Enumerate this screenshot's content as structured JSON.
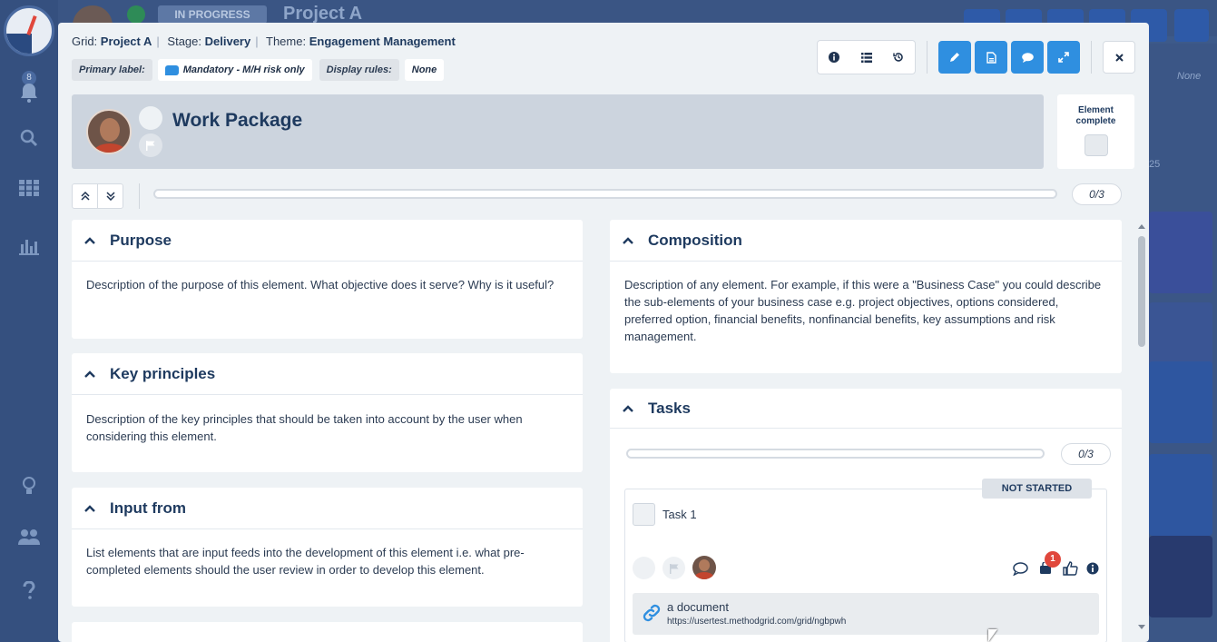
{
  "background": {
    "status_badge": "IN PROGRESS",
    "project_title": "Project A",
    "notification_count": "8",
    "right_col_label": "None",
    "right_col_number": "25"
  },
  "meta": {
    "grid_label": "Grid:",
    "grid_value": "Project A",
    "stage_label": "Stage:",
    "stage_value": "Delivery",
    "theme_label": "Theme:",
    "theme_value": "Engagement Management"
  },
  "labels": {
    "primary_label_title": "Primary label:",
    "primary_label_value": "Mandatory - M/H risk only",
    "display_rules_title": "Display rules:",
    "display_rules_value": "None"
  },
  "element": {
    "title": "Work Package",
    "complete_label": "Element complete",
    "progress_count": "0/3",
    "progress_fraction": 0
  },
  "panels": {
    "purpose": {
      "title": "Purpose",
      "body": "Description of the purpose of this element. What objective does it serve? Why is it useful?"
    },
    "key_principles": {
      "title": "Key principles",
      "body": "Description of the key principles that should be taken into account by the user when considering this element."
    },
    "input_from": {
      "title": "Input from",
      "body": "List elements that are input feeds into the development of this element i.e. what pre-completed elements should the user review in order to develop this element."
    },
    "composition": {
      "title": "Composition",
      "body": "Description of any element. For example, if this were a \"Business Case\" you could describe the sub-elements of your business case e.g. project objectives, options considered, preferred option, financial benefits, nonfinancial benefits, key assumptions and risk management."
    },
    "tasks": {
      "title": "Tasks",
      "progress_count": "0/3",
      "progress_fraction": 0,
      "task": {
        "status": "NOT STARTED",
        "name": "Task 1",
        "attachment_count": "1",
        "document_title": "a document",
        "document_url": "https://usertest.methodgrid.com/grid/ngbpwh"
      }
    }
  },
  "colors": {
    "accent_blue": "#2f8fe0",
    "badge_red": "#e0473c",
    "heading_navy": "#1e3a5f"
  },
  "icons": [
    "info-icon",
    "list-icon",
    "history-icon",
    "pencil-icon",
    "pdf-icon",
    "comment-icon",
    "expand-icon",
    "close-icon",
    "collapse-all-icon",
    "expand-all-icon",
    "chevron-up-icon",
    "flag-icon",
    "link-icon",
    "thumbs-up-icon",
    "paperclip-icon"
  ]
}
